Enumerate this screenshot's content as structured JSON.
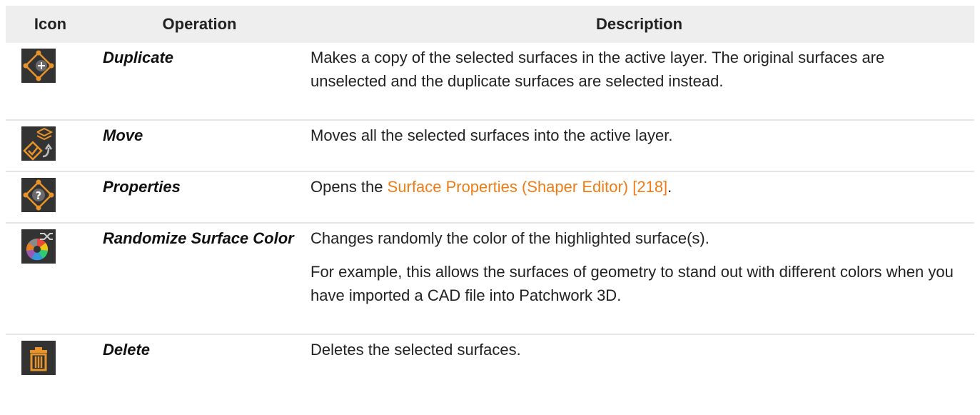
{
  "table": {
    "headers": {
      "icon": "Icon",
      "operation": "Operation",
      "description": "Description"
    },
    "rows": [
      {
        "icon": "duplicate-surface-icon",
        "operation": "Duplicate",
        "description": [
          "Makes a copy of the selected surfaces in the active layer. The original surfaces are unselected and the duplicate surfaces are selected instead."
        ]
      },
      {
        "icon": "move-to-layer-icon",
        "operation": "Move",
        "description": [
          "Moves all the selected surfaces into the active layer."
        ]
      },
      {
        "icon": "surface-properties-icon",
        "operation": "Properties",
        "description_prefix": "Opens the ",
        "link_text": "Surface Properties (Shaper Editor) [218]",
        "description_suffix": "."
      },
      {
        "icon": "randomize-color-icon",
        "operation": "Randomize Surface Color",
        "description": [
          "Changes randomly the color of the highlighted surface(s).",
          "For example, this allows the surfaces of geometry to stand out with different colors when you have imported a CAD file into Patchwork 3D."
        ]
      },
      {
        "icon": "trash-icon",
        "operation": "Delete",
        "description": [
          "Deletes the selected surfaces."
        ]
      }
    ]
  },
  "colors": {
    "icon_accent": "#e8942a",
    "icon_background": "#333333",
    "link": "#ef7d16",
    "header_background": "#eeeeee"
  }
}
